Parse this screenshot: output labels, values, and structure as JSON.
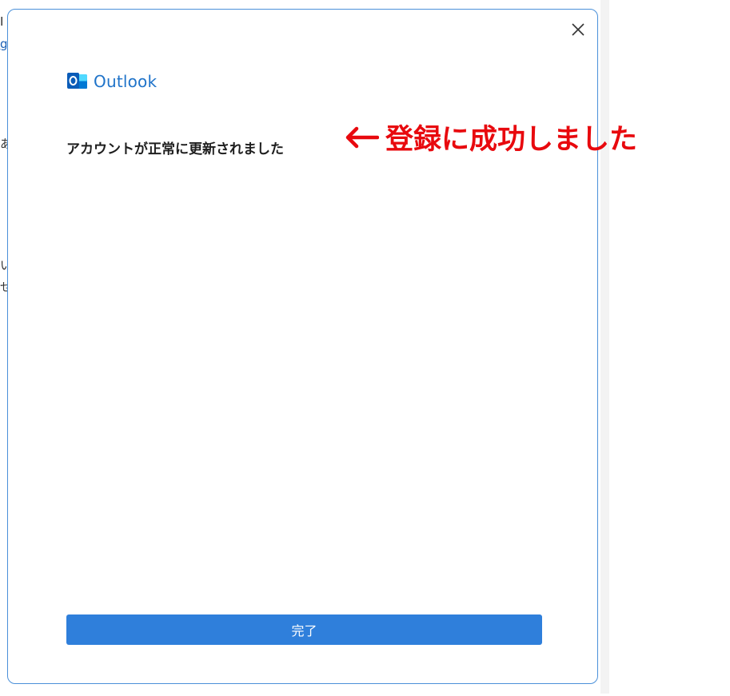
{
  "background": {
    "fragments": [
      "I",
      "g",
      "あ",
      "い",
      "せ"
    ]
  },
  "dialog": {
    "close_icon": "close-icon",
    "brand": {
      "logo_icon": "outlook-logo-icon",
      "name": "Outlook",
      "color": "#1f73c9"
    },
    "status_message": "アカウントが正常に更新されました",
    "done_button_label": "完了",
    "accent_color": "#2f7fdb",
    "border_color": "#4a90d9"
  },
  "annotation": {
    "arrow_icon": "left-arrow-icon",
    "text": "登録に成功しました",
    "color": "#e8090e"
  }
}
